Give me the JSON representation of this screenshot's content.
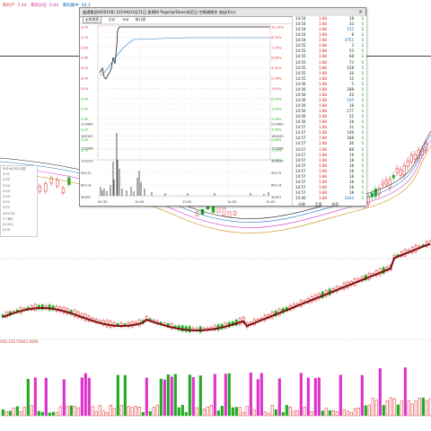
{
  "top_indicators": [
    {
      "label": "筹码产",
      "value": "2.44",
      "color": "#dd4444"
    },
    {
      "label": "筹码分位",
      "value": "0.64",
      "color": "#cc3399"
    },
    {
      "label": "筹码集中",
      "value": "93.1",
      "color": "#1166aa"
    }
  ],
  "left_info": {
    "header": "",
    "rows": [
      "2019/03/21/四",
      "3.51",
      "3.52",
      "3.52",
      "3.52",
      "3.53",
      "3.52",
      "3.51",
      "124.2万",
      "2.78亿",
      "(4.5%)",
      "(0.9)"
    ]
  },
  "popup": {
    "title": "盛通集团(600108) 2019年03月21日 星期四 PageUp/Down前后日 空格键操作 退出(Esc)",
    "close_glyph": "×",
    "tabs": [
      {
        "label": "走势图表",
        "active": true
      },
      {
        "label": "分价"
      },
      {
        "label": "TAB"
      },
      {
        "label": "统计表"
      }
    ],
    "chart_right_label": "中 连",
    "price_axis_left": [
      "3.75",
      "3.70",
      "3.65",
      "3.60",
      "3.55",
      "3.50",
      "3.45",
      "3.40",
      "3.35",
      "3.30",
      "3.25",
      "3.20",
      "3.15"
    ],
    "pct_axis_right": [
      "10.14%",
      "8.70%",
      "7.25%",
      "5.80%",
      "4.35%",
      "2.90%",
      "1.45%",
      "0.00%",
      "1.45%",
      "2.90%",
      "4.35%",
      "5.80%",
      "7.25%",
      "8.70%"
    ],
    "volume_axis": [
      "210400",
      "180343",
      "150286",
      "120229",
      "90172",
      "60114",
      "30057"
    ],
    "time_axis": [
      "09:30",
      "10:30",
      "13:00",
      "14:00",
      "15:00"
    ]
  },
  "trades": {
    "rows": [
      {
        "time": "14:54",
        "price": "3.88",
        "vol": "18",
        "dir": "S",
        "big": false
      },
      {
        "time": "14:54",
        "price": "3.88",
        "vol": "33",
        "dir": "S",
        "big": false
      },
      {
        "time": "14:54",
        "price": "3.88",
        "vol": "515",
        "dir": "S",
        "big": true
      },
      {
        "time": "14:54",
        "price": "3.88",
        "vol": "8",
        "dir": "S",
        "big": false
      },
      {
        "time": "14:54",
        "price": "3.88",
        "vol": "4751",
        "dir": "S",
        "big": true
      },
      {
        "time": "14:55",
        "price": "3.88",
        "vol": "3",
        "dir": "S",
        "big": false
      },
      {
        "time": "14:55",
        "price": "3.88",
        "vol": "53",
        "dir": "S",
        "big": false
      },
      {
        "time": "14:55",
        "price": "3.88",
        "vol": "68",
        "dir": "S",
        "big": false
      },
      {
        "time": "14:55",
        "price": "3.88",
        "vol": "73",
        "dir": "S",
        "big": false
      },
      {
        "time": "14:55",
        "price": "3.88",
        "vol": "158",
        "dir": "S",
        "big": false
      },
      {
        "time": "14:55",
        "price": "3.88",
        "vol": "36",
        "dir": "S",
        "big": false
      },
      {
        "time": "14:55",
        "price": "3.88",
        "vol": "15",
        "dir": "S",
        "big": false
      },
      {
        "time": "14:56",
        "price": "3.88",
        "vol": "5",
        "dir": "S",
        "big": false
      },
      {
        "time": "14:56",
        "price": "3.88",
        "vol": "188",
        "dir": "S",
        "big": false
      },
      {
        "time": "14:56",
        "price": "3.88",
        "vol": "20",
        "dir": "S",
        "big": false
      },
      {
        "time": "14:56",
        "price": "3.88",
        "vol": "545",
        "dir": "S",
        "big": true
      },
      {
        "time": "14:56",
        "price": "3.88",
        "vol": "18",
        "dir": "S",
        "big": false
      },
      {
        "time": "14:56",
        "price": "3.88",
        "vol": "177",
        "dir": "S",
        "big": false
      },
      {
        "time": "14:56",
        "price": "3.88",
        "vol": "25",
        "dir": "S",
        "big": false
      },
      {
        "time": "14:56",
        "price": "3.88",
        "vol": "18",
        "dir": "S",
        "big": false
      },
      {
        "time": "14:57",
        "price": "3.88",
        "vol": "32",
        "dir": "S",
        "big": false
      },
      {
        "time": "14:57",
        "price": "3.88",
        "vol": "149",
        "dir": "S",
        "big": false
      },
      {
        "time": "14:57",
        "price": "3.88",
        "vol": "188",
        "dir": "S",
        "big": false
      },
      {
        "time": "14:57",
        "price": "3.88",
        "vol": "36",
        "dir": "S",
        "big": false
      },
      {
        "time": "14:57",
        "price": "3.88",
        "vol": "88",
        "dir": "S",
        "big": false
      },
      {
        "time": "14:57",
        "price": "3.88",
        "vol": "18",
        "dir": "S",
        "big": false
      },
      {
        "time": "14:57",
        "price": "3.88",
        "vol": "18",
        "dir": "S",
        "big": false
      },
      {
        "time": "14:57",
        "price": "3.88",
        "vol": "18",
        "dir": "S",
        "big": false
      },
      {
        "time": "14:57",
        "price": "3.88",
        "vol": "18",
        "dir": "S",
        "big": false
      },
      {
        "time": "14:57",
        "price": "3.88",
        "vol": "18",
        "dir": "S",
        "big": false
      },
      {
        "time": "14:57",
        "price": "3.88",
        "vol": "18",
        "dir": "S",
        "big": false
      },
      {
        "time": "14:57",
        "price": "3.88",
        "vol": "18",
        "dir": "S",
        "big": false
      },
      {
        "time": "14:57",
        "price": "3.88",
        "vol": "18",
        "dir": "S",
        "big": false
      },
      {
        "time": "15:00",
        "price": "3.88",
        "vol": "2434",
        "dir": "S",
        "big": true
      }
    ]
  },
  "buy_sell_labels": [
    "分钟",
    "买盘",
    "卖盘"
  ],
  "volume_label": "VOL:135  55922.4000",
  "colors": {
    "up": "#dd2222",
    "down": "#22aa22",
    "ma1": "#222222",
    "ma2": "#cc8800",
    "ma3": "#2277cc",
    "ma4": "#cc33cc"
  }
}
